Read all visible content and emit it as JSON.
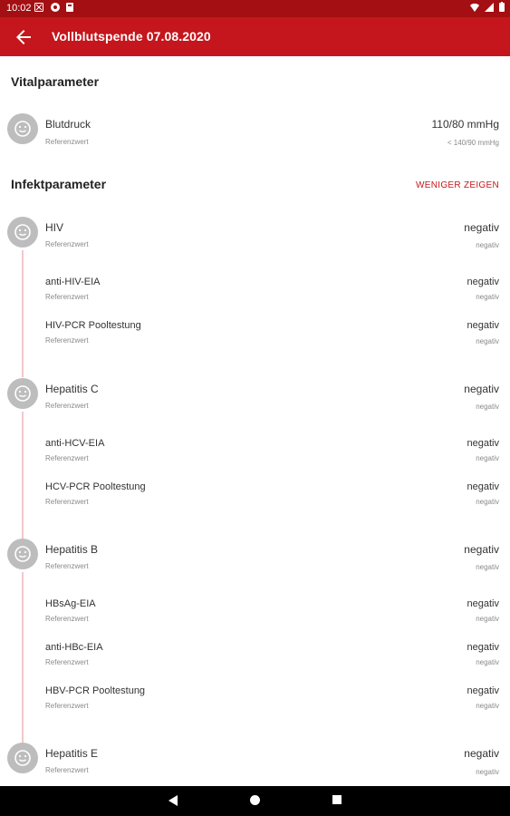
{
  "status_bar": {
    "time": "10:02"
  },
  "app_bar": {
    "title": "Vollblutspende 07.08.2020"
  },
  "vital": {
    "title": "Vitalparameter",
    "rows": [
      {
        "name": "Blutdruck",
        "ref_label": "Referenzwert",
        "value": "110/80 mmHg",
        "ref_value": "< 140/90 mmHg"
      }
    ]
  },
  "infekt": {
    "title": "Infektparameter",
    "toggle_label": "WENIGER ZEIGEN",
    "groups": [
      {
        "name": "HIV",
        "ref_label": "Referenzwert",
        "value": "negativ",
        "ref_value": "negativ",
        "items": [
          {
            "name": "anti-HIV-EIA",
            "ref_label": "Referenzwert",
            "value": "negativ",
            "ref_value": "negativ"
          },
          {
            "name": "HIV-PCR Pooltestung",
            "ref_label": "Referenzwert",
            "value": "negativ",
            "ref_value": "negativ"
          }
        ]
      },
      {
        "name": "Hepatitis C",
        "ref_label": "Referenzwert",
        "value": "negativ",
        "ref_value": "negativ",
        "items": [
          {
            "name": "anti-HCV-EIA",
            "ref_label": "Referenzwert",
            "value": "negativ",
            "ref_value": "negativ"
          },
          {
            "name": "HCV-PCR Pooltestung",
            "ref_label": "Referenzwert",
            "value": "negativ",
            "ref_value": "negativ"
          }
        ]
      },
      {
        "name": "Hepatitis B",
        "ref_label": "Referenzwert",
        "value": "negativ",
        "ref_value": "negativ",
        "items": [
          {
            "name": "HBsAg-EIA",
            "ref_label": "Referenzwert",
            "value": "negativ",
            "ref_value": "negativ"
          },
          {
            "name": "anti-HBc-EIA",
            "ref_label": "Referenzwert",
            "value": "negativ",
            "ref_value": "negativ"
          },
          {
            "name": "HBV-PCR Pooltestung",
            "ref_label": "Referenzwert",
            "value": "negativ",
            "ref_value": "negativ"
          }
        ]
      },
      {
        "name": "Hepatitis E",
        "ref_label": "Referenzwert",
        "value": "negativ",
        "ref_value": "negativ",
        "items": []
      }
    ]
  },
  "icons": {
    "back": "arrow-left-icon",
    "avatar": "smiley-face-icon",
    "nav_back": "triangle-back-icon",
    "nav_home": "circle-home-icon",
    "nav_recents": "square-recents-icon"
  },
  "colors": {
    "app_bar": "#c4161c",
    "status_bar": "#a30f12",
    "accent": "#c4161c",
    "timeline": "#f2c8ca",
    "avatar": "#bdbdbd"
  }
}
